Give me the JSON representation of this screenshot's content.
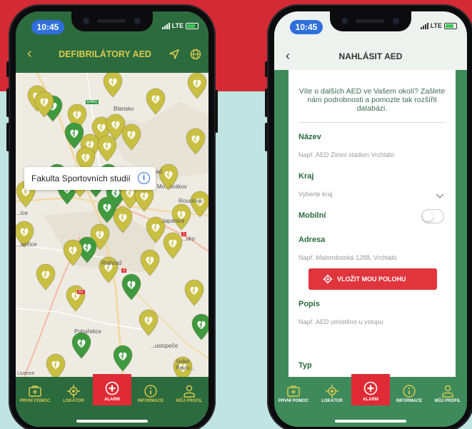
{
  "status": {
    "time": "10:45",
    "network": "LTE"
  },
  "left_phone": {
    "header": {
      "title": "DEFIBRILÁTORY AED"
    },
    "tooltip": {
      "label": "Fakulta Sportovních studií",
      "icon": "info-icon"
    },
    "map_labels": {
      "blansko": "Blansko",
      "road_e461": "E461",
      "morakov": "Mo...orákov",
      "rousinov": "Rousínov",
      "slapanice": "...lapanice",
      "ice": "...ice",
      "slavkov": "...vko",
      "rancice": "...ančice",
      "rajhrad": "Rajhrad",
      "road_52": "52",
      "road_2": "2",
      "road_1": "1",
      "pohorelice": "Pohořelice",
      "ustopece": "...ustopeče",
      "velke_pavlov": "Velké Pavlo...",
      "licence": "Licence",
      "ad": "ad"
    }
  },
  "right_phone": {
    "header": {
      "title": "NAHLÁSIT AED"
    },
    "intro": "Víte o dalších AED ve Vašem okolí? Zašlete nám podrobnosti a pomozte tak rozšířit databázi.",
    "form": {
      "name_label": "Název",
      "name_placeholder": "Např. AED Zimní stadion Vrchlabí",
      "region_label": "Kraj",
      "region_placeholder": "Vyberte kraj",
      "mobile_label": "Mobilní",
      "mobile_on": false,
      "address_label": "Adresa",
      "address_placeholder": "Např. Maloměstská 1288, Vrchlabí",
      "location_button": "VLOŽIT MOU POLOHU",
      "description_label": "Popis",
      "description_placeholder": "Např. AED umístěno u vstupu",
      "type_label": "Typ"
    }
  },
  "tabbar": {
    "first_aid": "PRVNÍ POMOC",
    "locator": "LOKÁTOR",
    "alarm": "ALARM",
    "info": "INFORMACE",
    "profile": "MŮJ PROFIL"
  },
  "colors": {
    "brand_green": "#2b6b3e",
    "accent_yellow": "#d9c94f",
    "alarm_red": "#e02b36",
    "pin_olive": "#c9bf42",
    "pin_green": "#3f9a3f"
  }
}
